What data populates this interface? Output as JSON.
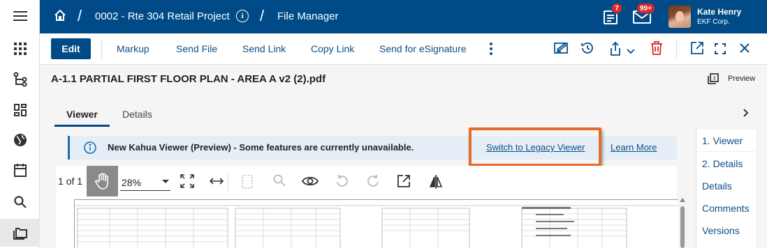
{
  "rail": {
    "items": [
      {
        "icon": "hamburger-menu-icon"
      },
      {
        "icon": "apps-grid-icon"
      },
      {
        "icon": "hierarchy-icon"
      },
      {
        "icon": "dashboard-icon"
      },
      {
        "icon": "globe-icon"
      },
      {
        "icon": "calendar-icon"
      },
      {
        "icon": "search-icon"
      },
      {
        "icon": "files-icon"
      }
    ]
  },
  "header": {
    "project": "0002 - Rte 304 Retail Project",
    "section": "File Manager",
    "tasks_badge": "7",
    "messages_badge": "99+",
    "user_name": "Kate Henry",
    "user_org": "EKF Corp."
  },
  "toolbar": {
    "edit_label": "Edit",
    "markup_label": "Markup",
    "send_file_label": "Send File",
    "send_link_label": "Send Link",
    "copy_link_label": "Copy Link",
    "esign_label": "Send for eSignature"
  },
  "file": {
    "title": "A-1.1 PARTIAL FIRST FLOOR PLAN - AREA A v2 (2).pdf",
    "preview_label": "Preview"
  },
  "tabs": [
    {
      "label": "Viewer",
      "active": true
    },
    {
      "label": "Details",
      "active": false
    }
  ],
  "banner": {
    "message": "New Kahua Viewer (Preview) - Some features are currently unavailable.",
    "legacy_link": "Switch to Legacy Viewer",
    "learn_more_link": "Learn More"
  },
  "viewer": {
    "page_indicator": "1 of 1",
    "zoom": "28%"
  },
  "right_panel": {
    "items": [
      "1. Viewer",
      "2. Details",
      "Details",
      "Comments",
      "Versions"
    ]
  },
  "colors": {
    "brand": "#004b87",
    "link": "#0c4f8a",
    "highlight": "#e36c2a",
    "badge": "#d9262c",
    "banner_bg": "#e5eef6"
  }
}
